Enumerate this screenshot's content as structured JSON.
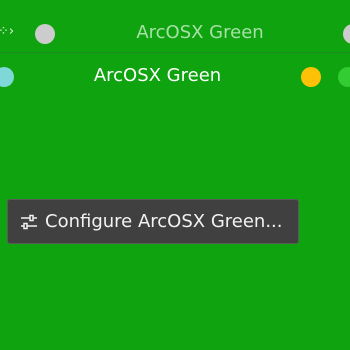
{
  "window_back": {
    "title": "ArcOSX Green"
  },
  "window_front": {
    "title": "ArcOSX Green"
  },
  "context_menu": {
    "configure_label": "Configure ArcOSX Green...",
    "icon": "sliders-icon"
  },
  "colors": {
    "background": "#0fa30f",
    "button_inactive": "#cccccc",
    "button_cyan": "#7fd8d8",
    "button_minimize": "#ffc107",
    "button_maximize": "#33cc33",
    "popup_bg": "#404040"
  }
}
